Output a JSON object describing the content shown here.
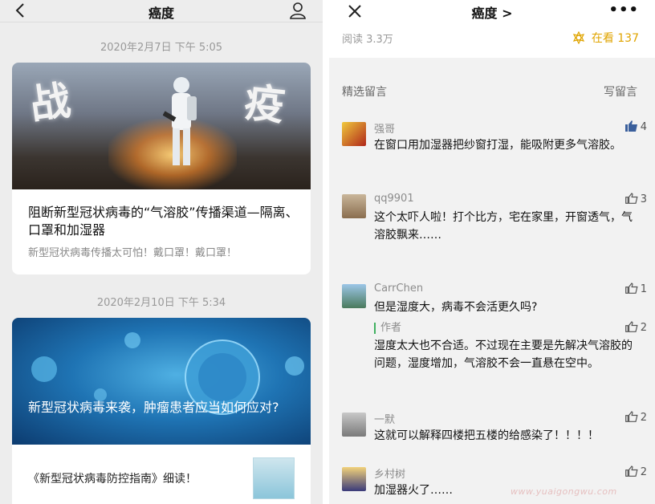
{
  "left": {
    "header": {
      "title": "癌度"
    },
    "articles": [
      {
        "date": "2020年2月7日 下午 5:05",
        "image_words": [
          "战",
          "疫"
        ],
        "title": "阻断新型冠状病毒的“气溶胶”传播渠道—隔离、口罩和加湿器",
        "subtitle": "新型冠状病毒传播太可怕！戴口罩！戴口罩！"
      },
      {
        "date": "2020年2月10日 下午 5:34",
        "title": "新型冠状病毒来袭，肿瘤患者应当如何应对?",
        "subtitle": "《新型冠状病毒防控指南》细读！"
      }
    ]
  },
  "right": {
    "header": {
      "title": "癌度 >"
    },
    "stats": {
      "reads": "阅读 3.3万",
      "zaikan": "在看 137",
      "accent": "#e0a400"
    },
    "section": {
      "left": "精选留言",
      "right": "写留言"
    },
    "comments": [
      {
        "name": "强哥",
        "likes": "4",
        "text": "在窗口用加湿器把纱窗打湿，能吸附更多气溶胶。",
        "liked": true
      },
      {
        "name": "qq9901",
        "likes": "3",
        "text": "这个太吓人啦！打个比方，宅在家里，开窗透气，气溶胶飘来……"
      },
      {
        "name": "CarrChen",
        "likes": "1",
        "text": "但是湿度大，病毒不会活更久吗?",
        "reply": {
          "label": "作者",
          "likes": "2",
          "text": "湿度太大也不合适。不过现在主要是先解决气溶胶的问题，湿度增加，气溶胶不会一直悬在空中。"
        }
      },
      {
        "name": "一默",
        "likes": "2",
        "text": "这就可以解释四楼把五楼的给感染了！！！！"
      },
      {
        "name": "乡村树",
        "likes": "2",
        "text": "加湿器火了……"
      }
    ]
  },
  "watermark": "www.yuaigongwu.com"
}
